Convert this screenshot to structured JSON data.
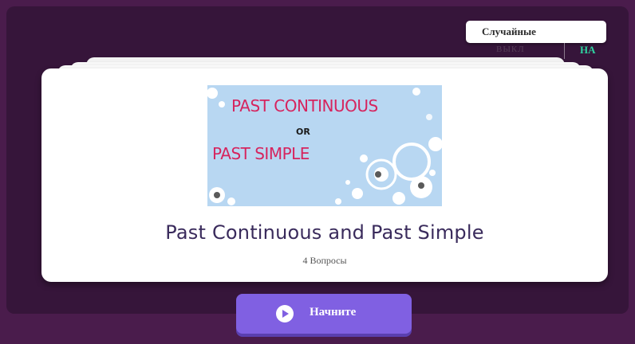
{
  "random_toggle": {
    "label": "Случайные",
    "off_label": "ВЫКЛ",
    "on_label": "НА"
  },
  "quiz": {
    "cover": {
      "line1": "PAST CONTINUOUS",
      "line2": "OR",
      "line3": "PAST SIMPLE"
    },
    "title": "Past Continuous and Past Simple",
    "questions_count": "4 Вопросы"
  },
  "start_button": {
    "label": "Начните",
    "icon": "play-icon"
  },
  "colors": {
    "background": "#36153a",
    "accent": "#8060e2",
    "toggle_on": "#2fd3a0",
    "cover_text": "#d6245e",
    "title_text": "#3a2b5c"
  }
}
